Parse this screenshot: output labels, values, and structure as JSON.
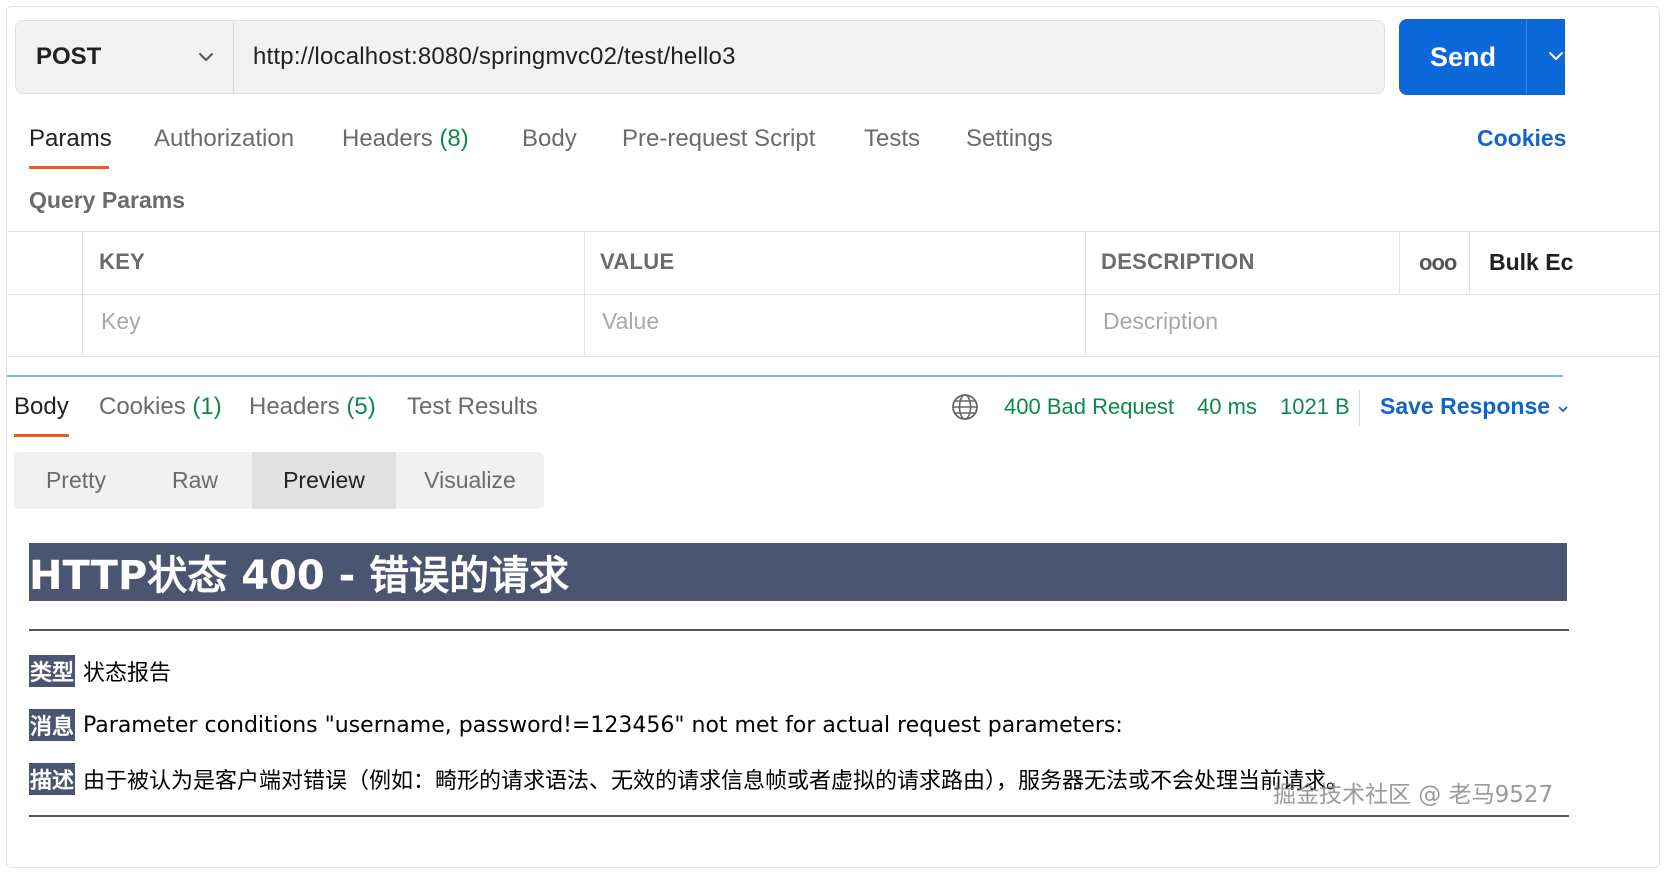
{
  "request": {
    "method": "POST",
    "url": "http://localhost:8080/springmvc02/test/hello3",
    "send_label": "Send"
  },
  "request_tabs": {
    "params": "Params",
    "authorization": "Authorization",
    "headers": "Headers",
    "headers_count": "(8)",
    "body": "Body",
    "prerequest": "Pre-request Script",
    "tests": "Tests",
    "settings": "Settings",
    "cookies_link": "Cookies"
  },
  "query_params": {
    "title": "Query Params",
    "columns": {
      "key": "KEY",
      "value": "VALUE",
      "description": "DESCRIPTION"
    },
    "placeholders": {
      "key": "Key",
      "value": "Value",
      "description": "Description"
    },
    "more_icon": "ooo",
    "bulk_edit": "Bulk Ec"
  },
  "response_tabs": {
    "body": "Body",
    "cookies": "Cookies",
    "cookies_count": "(1)",
    "headers": "Headers",
    "headers_count": "(5)",
    "test_results": "Test Results"
  },
  "response_meta": {
    "status": "400 Bad Request",
    "time": "40 ms",
    "size": "1021 B",
    "save_response": "Save Response",
    "status_color": "#0d8a4a"
  },
  "view_modes": [
    "Pretty",
    "Raw",
    "Preview",
    "Visualize"
  ],
  "active_view_mode": "Preview",
  "preview": {
    "heading": "HTTP状态 400 - 错误的请求",
    "type_label": "类型",
    "type_value": "状态报告",
    "message_label": "消息",
    "message_value": "Parameter conditions \"username, password!=123456\" not met for actual request parameters:",
    "description_label": "描述",
    "description_value": "由于被认为是客户端对错误（例如：畸形的请求语法、无效的请求信息帧或者虚拟的请求路由），服务器无法或不会处理当前请求。"
  },
  "watermark": "掘金技术社区 @ 老马9527",
  "colors": {
    "accent_blue": "#0b68d9",
    "tab_underline": "#ea5b2c",
    "banner_bg": "#4a5571"
  }
}
